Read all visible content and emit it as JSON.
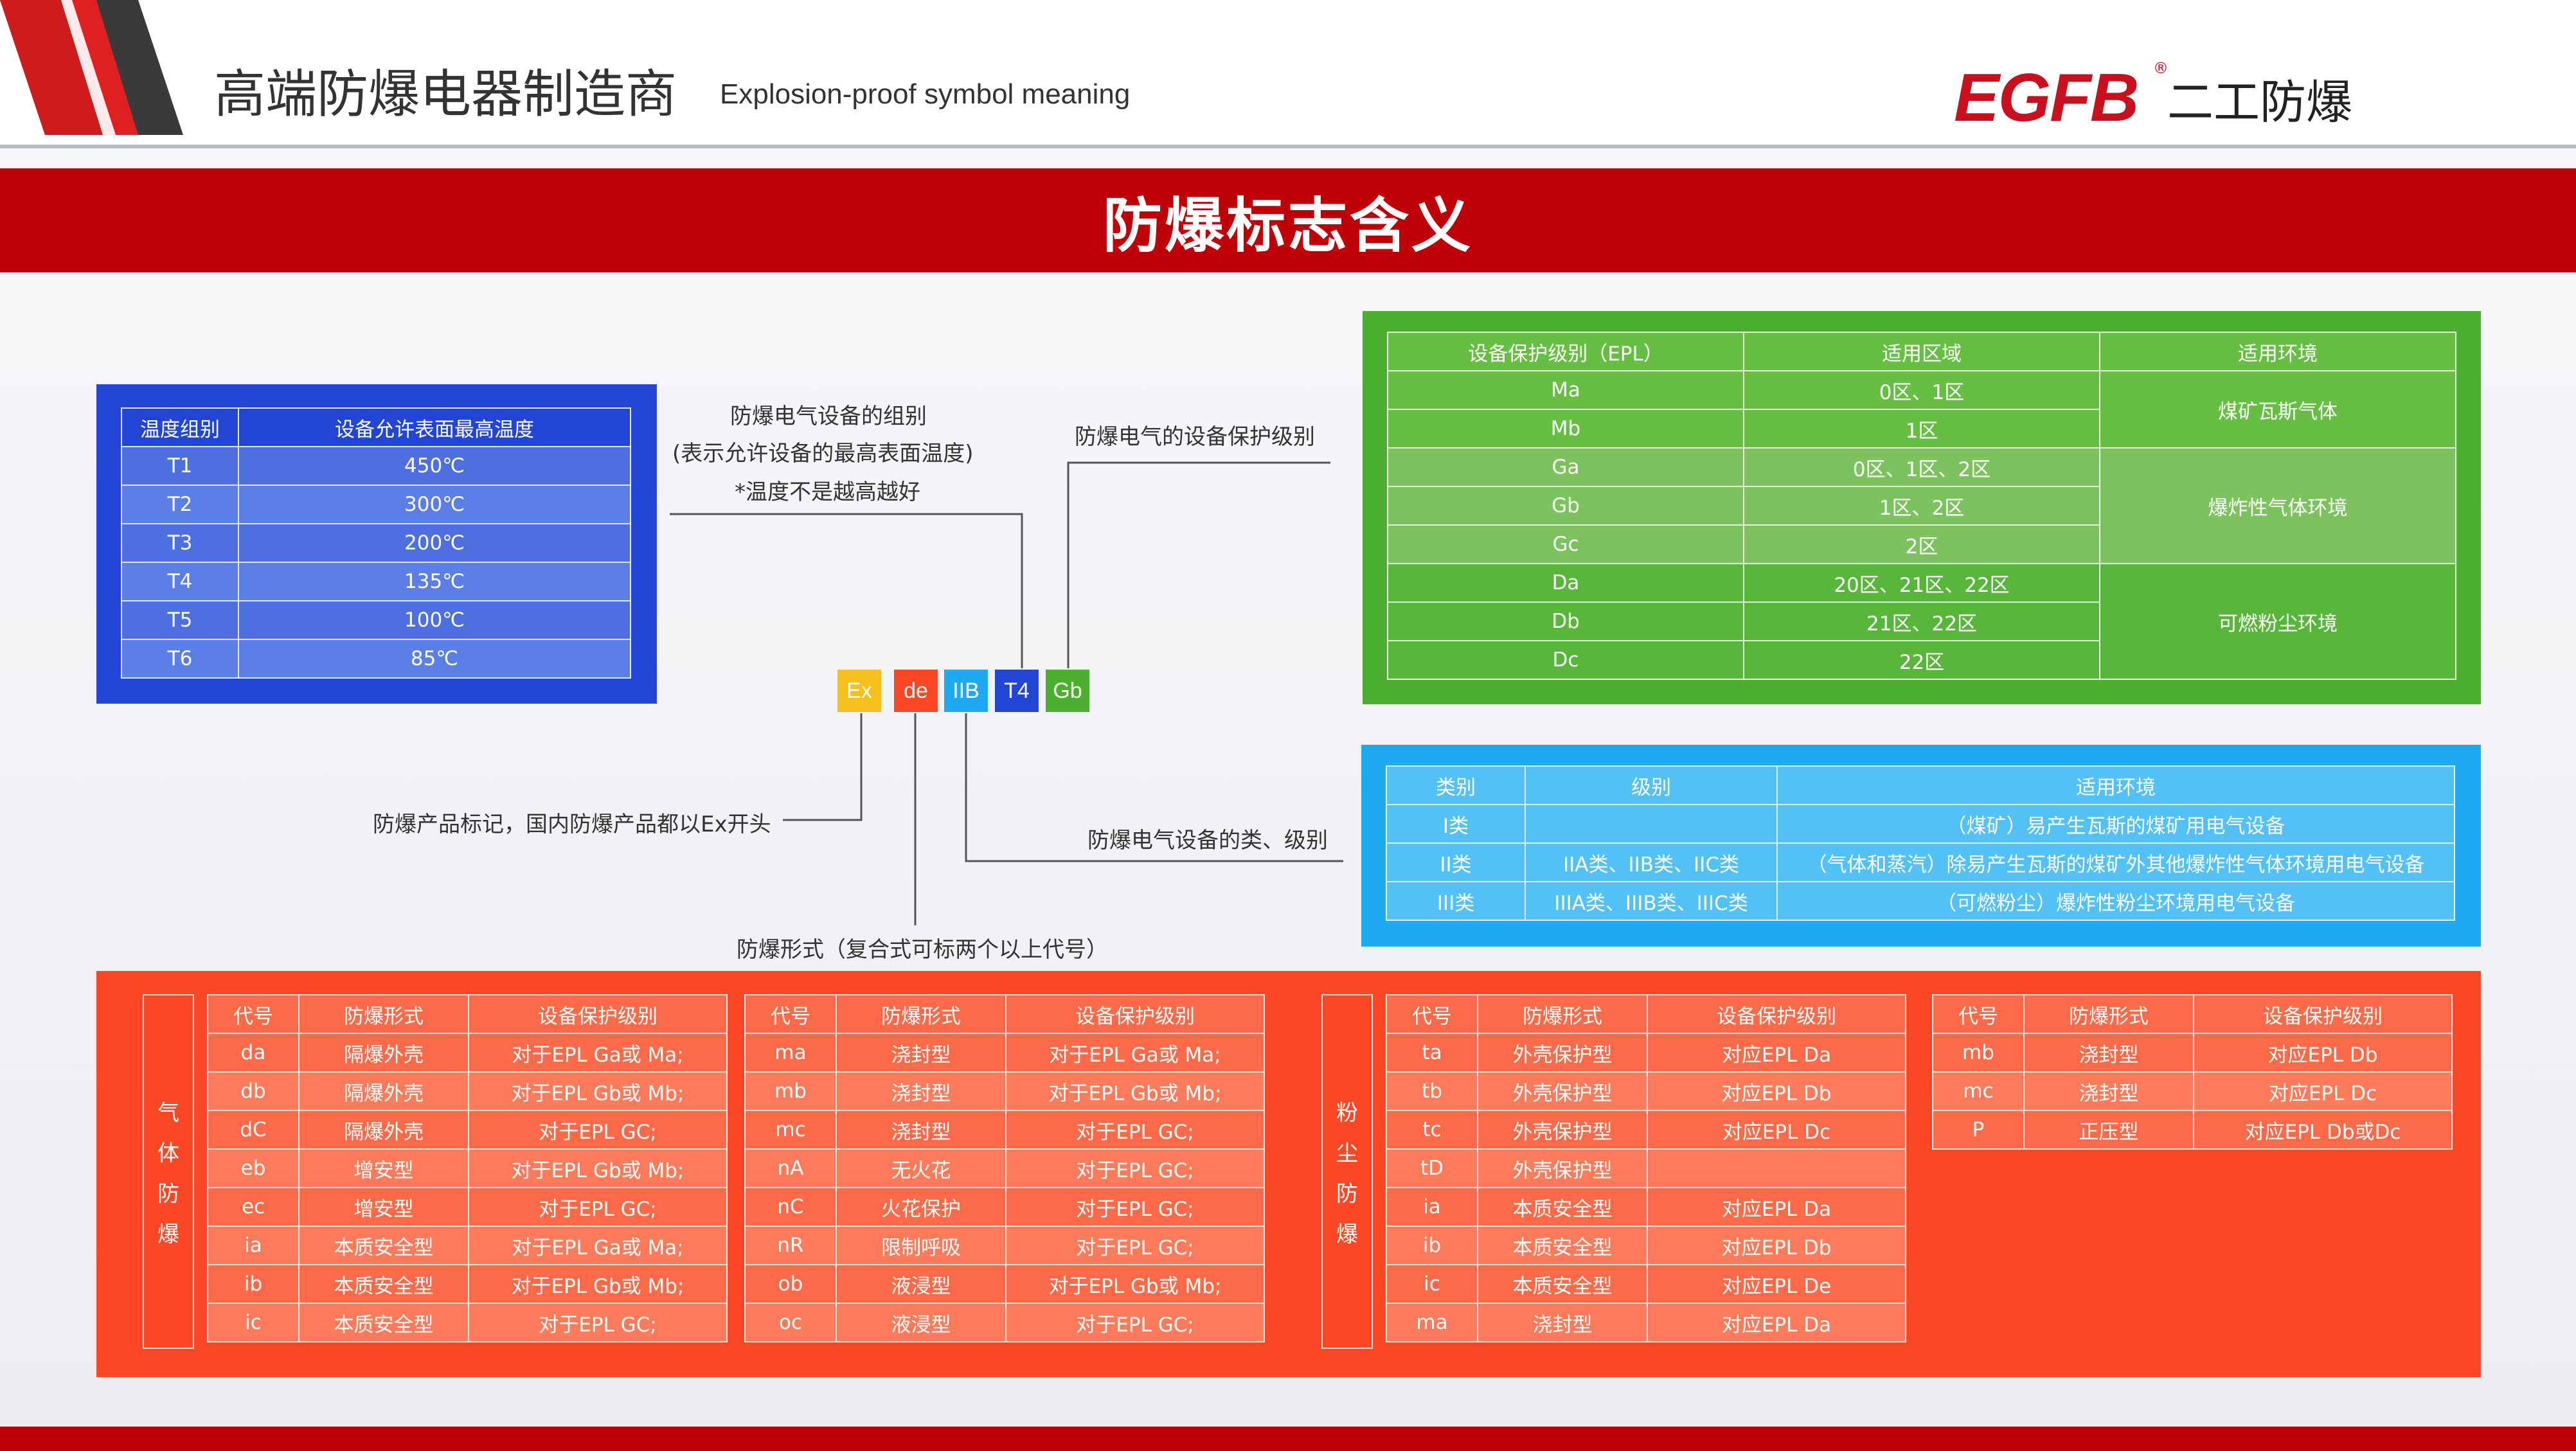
{
  "header": {
    "title_cn": "高端防爆电器制造商",
    "title_en": "Explosion-proof symbol meaning",
    "logo": "EGFB",
    "logo_reg": "®",
    "logo_cn": "二工防爆"
  },
  "banner": {
    "title": "防爆标志含义"
  },
  "symbol": {
    "parts": [
      {
        "text": "Ex",
        "color": "#f5c01c"
      },
      {
        "text": "de",
        "color": "#fb4724"
      },
      {
        "text": "IIB",
        "color": "#1eaaf1"
      },
      {
        "text": "T4",
        "color": "#2345d4"
      },
      {
        "text": "Gb",
        "color": "#4caf2f"
      }
    ]
  },
  "annotations": {
    "temp_group_l1": "防爆电气设备的组别",
    "temp_group_l2": "(表示允许设备的最高表面温度)",
    "temp_group_l3": "*温度不是越高越好",
    "epl": "防爆电气的设备保护级别",
    "ex_mark": "防爆产品标记，国内防爆产品都以Ex开头",
    "class": "防爆电气设备的类、级别",
    "form": "防爆形式（复合式可标两个以上代号）"
  },
  "temp_table": {
    "headers": [
      "温度组别",
      "设备允许表面最高温度"
    ],
    "rows": [
      [
        "T1",
        "450℃"
      ],
      [
        "T2",
        "300℃"
      ],
      [
        "T3",
        "200℃"
      ],
      [
        "T4",
        "135℃"
      ],
      [
        "T5",
        "100℃"
      ],
      [
        "T6",
        "85℃"
      ]
    ]
  },
  "epl_table": {
    "headers": [
      "设备保护级别（EPL）",
      "适用区域",
      "适用环境"
    ],
    "rows": [
      [
        "Ma",
        "0区、1区"
      ],
      [
        "Mb",
        "1区"
      ],
      [
        "Ga",
        "0区、1区、2区"
      ],
      [
        "Gb",
        "1区、2区"
      ],
      [
        "Gc",
        "2区"
      ],
      [
        "Da",
        "20区、21区、22区"
      ],
      [
        "Db",
        "21区、22区"
      ],
      [
        "Dc",
        "22区"
      ]
    ],
    "env": [
      "煤矿瓦斯气体",
      "爆炸性气体环境",
      "可燃粉尘环境"
    ]
  },
  "class_table": {
    "headers": [
      "类别",
      "级别",
      "适用环境"
    ],
    "rows": [
      [
        "I类",
        "",
        "（煤矿）易产生瓦斯的煤矿用电气设备"
      ],
      [
        "II类",
        "IIA类、IIB类、IIC类",
        "（气体和蒸汽）除易产生瓦斯的煤矿外其他爆炸性气体环境用电气设备"
      ],
      [
        "III类",
        "IIIA类、IIIB类、IIIC类",
        "（可燃粉尘）爆炸性粉尘环境用电气设备"
      ]
    ]
  },
  "types": {
    "gas_label": [
      "气",
      "体",
      "防",
      "爆"
    ],
    "dust_label": [
      "粉",
      "尘",
      "防",
      "爆"
    ],
    "headers": [
      "代号",
      "防爆形式",
      "设备保护级别"
    ],
    "gas_a": [
      [
        "da",
        "隔爆外壳",
        "对于EPL Ga或 Ma;"
      ],
      [
        "db",
        "隔爆外壳",
        "对于EPL Gb或 Mb;"
      ],
      [
        "dC",
        "隔爆外壳",
        "对于EPL GC;"
      ],
      [
        "eb",
        "增安型",
        "对于EPL Gb或 Mb;"
      ],
      [
        "ec",
        "增安型",
        "对于EPL GC;"
      ],
      [
        "ia",
        "本质安全型",
        "对于EPL Ga或 Ma;"
      ],
      [
        "ib",
        "本质安全型",
        "对于EPL Gb或 Mb;"
      ],
      [
        "ic",
        "本质安全型",
        "对于EPL GC;"
      ]
    ],
    "gas_b": [
      [
        "ma",
        "浇封型",
        "对于EPL Ga或 Ma;"
      ],
      [
        "mb",
        "浇封型",
        "对于EPL Gb或 Mb;"
      ],
      [
        "mc",
        "浇封型",
        "对于EPL GC;"
      ],
      [
        "nA",
        "无火花",
        "对于EPL GC;"
      ],
      [
        "nC",
        "火花保护",
        "对于EPL GC;"
      ],
      [
        "nR",
        "限制呼吸",
        "对于EPL GC;"
      ],
      [
        "ob",
        "液浸型",
        "对于EPL Gb或 Mb;"
      ],
      [
        "oc",
        "液浸型",
        "对于EPL GC;"
      ]
    ],
    "dust_a": [
      [
        "ta",
        "外壳保护型",
        "对应EPL Da"
      ],
      [
        "tb",
        "外壳保护型",
        "对应EPL Db"
      ],
      [
        "tc",
        "外壳保护型",
        "对应EPL Dc"
      ],
      [
        "tD",
        "外壳保护型",
        ""
      ],
      [
        "ia",
        "本质安全型",
        "对应EPL Da"
      ],
      [
        "ib",
        "本质安全型",
        "对应EPL Db"
      ],
      [
        "ic",
        "本质安全型",
        "对应EPL De"
      ],
      [
        "ma",
        "浇封型",
        "对应EPL Da"
      ]
    ],
    "dust_b": [
      [
        "mb",
        "浇封型",
        "对应EPL Db"
      ],
      [
        "mc",
        "浇封型",
        "对应EPL Dc"
      ],
      [
        "P",
        "正压型",
        "对应EPL Db或Dc"
      ]
    ]
  }
}
